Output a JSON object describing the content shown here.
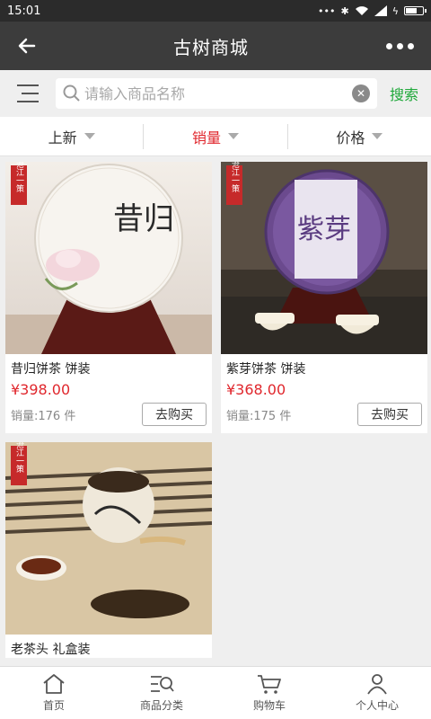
{
  "status": {
    "time": "15:01"
  },
  "header": {
    "title": "古树商城"
  },
  "search": {
    "placeholder": "请输入商品名称",
    "button": "搜索"
  },
  "sort": [
    {
      "label": "上新"
    },
    {
      "label": "销量"
    },
    {
      "label": "价格"
    }
  ],
  "products": [
    {
      "name": "昔归饼茶 饼装",
      "price": "¥398.00",
      "sales": "销量:176 件",
      "buy": "去购买",
      "seal": "沧江一策",
      "cake_label": "昔归"
    },
    {
      "name": "紫芽饼茶 饼装",
      "price": "¥368.00",
      "sales": "销量:175 件",
      "buy": "去购买",
      "seal": "沧江一策",
      "cake_label": "紫芽"
    },
    {
      "name": "老茶头 礼盒装",
      "seal": "沧江一策"
    }
  ],
  "tabs": [
    {
      "label": "首页"
    },
    {
      "label": "商品分类"
    },
    {
      "label": "购物车"
    },
    {
      "label": "个人中心"
    }
  ],
  "colors": {
    "accent": "#e0272d",
    "search": "#1fa83a",
    "topbar": "#3c3c3c"
  }
}
